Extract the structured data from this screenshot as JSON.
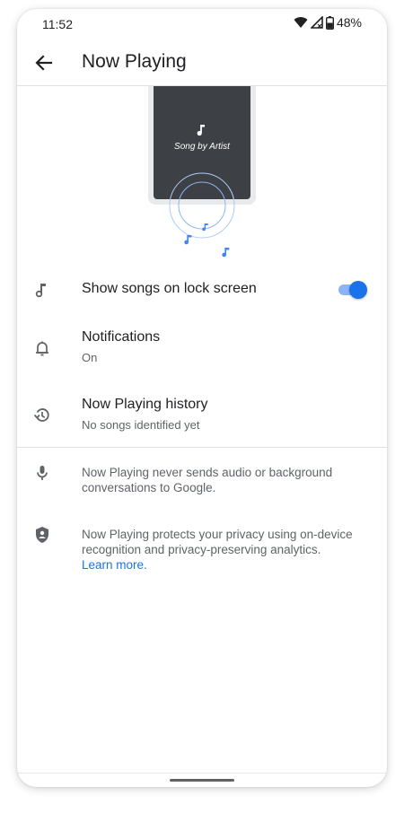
{
  "status_bar": {
    "time": "11:52",
    "battery": "48%",
    "icons": [
      "wifi-icon",
      "signal-icon",
      "battery-icon"
    ]
  },
  "app_bar": {
    "title": "Now Playing",
    "back_icon": "arrow-back-icon"
  },
  "illustration": {
    "song_caption": "Song by Artist",
    "accent_color": "#4285f4"
  },
  "settings": {
    "lock_screen": {
      "label": "Show songs on lock screen",
      "enabled": true,
      "icon": "music-note-icon"
    },
    "notifications": {
      "label": "Notifications",
      "value": "On",
      "icon": "bell-icon"
    },
    "history": {
      "label": "Now Playing history",
      "value": "No songs identified yet",
      "icon": "history-icon"
    }
  },
  "info": {
    "mic_text": "Now Playing never sends audio or background conversations to Google.",
    "privacy_text": "Now Playing protects your privacy using on-device recognition and privacy-preserving analytics.",
    "learn_more": "Learn more."
  },
  "colors": {
    "accent": "#1a73e8",
    "text_primary": "#202124",
    "text_secondary": "#5f6368"
  }
}
